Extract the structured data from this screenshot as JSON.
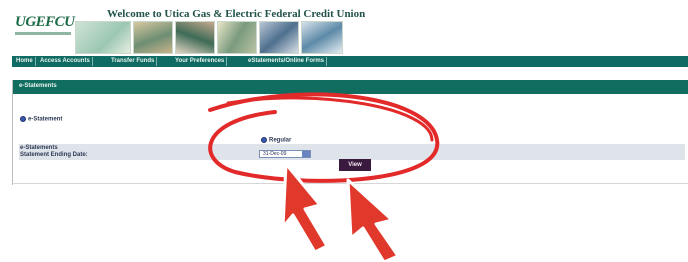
{
  "header": {
    "logo_text": "UGEFCU",
    "title": "Welcome to Utica Gas & Electric Federal Credit Union"
  },
  "nav": {
    "items": [
      {
        "label": "Home"
      },
      {
        "label": "Access Accounts"
      },
      {
        "label": "Transfer Funds"
      },
      {
        "label": "Your Preferences"
      },
      {
        "label": "eStatements/Online Forms"
      }
    ]
  },
  "panel": {
    "title": "e-Statements",
    "statement_option_label": "e-Statement",
    "form": {
      "estatements_label": "e-Statements",
      "ending_date_label": "Statement Ending Date:",
      "regular_option": "Regular",
      "date_value": "31-Dec-09"
    },
    "view_button": "View"
  },
  "annotation_colors": {
    "circle": "#e32a2a",
    "arrow": "#e1382c"
  }
}
